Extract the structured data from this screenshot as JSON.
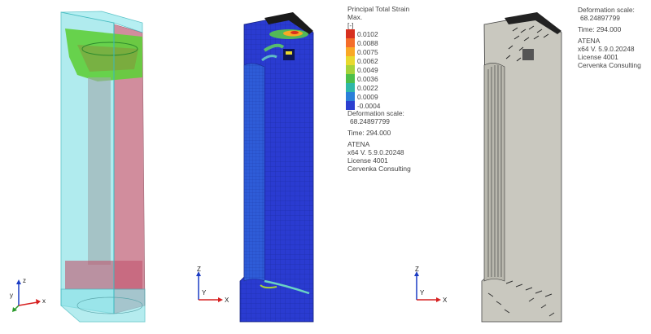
{
  "legend": {
    "title": "Principal Total Strain",
    "subtitle": "Max.",
    "unit": "[-]",
    "entries": [
      {
        "value": "0.0102",
        "color": "#d7301f"
      },
      {
        "value": "0.0088",
        "color": "#f46d2a"
      },
      {
        "value": "0.0075",
        "color": "#f9a825"
      },
      {
        "value": "0.0062",
        "color": "#e8d92e"
      },
      {
        "value": "0.0049",
        "color": "#a6d33a"
      },
      {
        "value": "0.0036",
        "color": "#4cbf4a"
      },
      {
        "value": "0.0022",
        "color": "#2fb8a8"
      },
      {
        "value": "0.0009",
        "color": "#2b7fd9"
      },
      {
        "value": "-0.0004",
        "color": "#2b3fd0"
      }
    ]
  },
  "info_middle": {
    "deformation_label": "Deformation scale:",
    "deformation_value": "68.24897799",
    "time_text": "Time:  294.000",
    "app": "ATENA",
    "version": "x64 V. 5.9.0.20248",
    "license": "License 4001",
    "company": "Cervenka Consulting"
  },
  "info_right": {
    "deformation_label": "Deformation scale:",
    "deformation_value": "68.24897799",
    "time_text": "Time:  294.000",
    "app": "ATENA",
    "version": "x64 V. 5.9.0.20248",
    "license": "License 4001",
    "company": "Cervenka Consulting"
  },
  "axes": {
    "z": "Z",
    "y": "Y",
    "x": "X",
    "z_small": "z",
    "y_small": "y",
    "x_small": "x"
  },
  "colors": {
    "mesh_blue": "#2a3bd1",
    "transparent_cyan": "#7fe0e6",
    "pink": "#c97a8c",
    "grey_model": "#c9c8bf"
  }
}
